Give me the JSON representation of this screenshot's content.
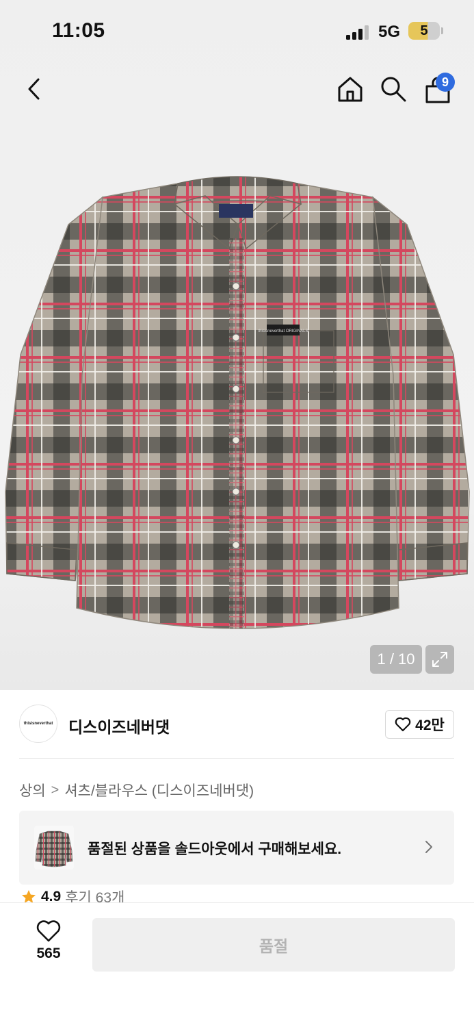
{
  "status_bar": {
    "time": "11:05",
    "network": "5G",
    "battery": "5"
  },
  "header": {
    "back_icon": "chevron-left-icon",
    "home_icon": "home-icon",
    "search_icon": "search-icon",
    "cart_icon": "shopping-bag-icon",
    "cart_count": "9"
  },
  "gallery": {
    "pager": "1 / 10",
    "expand_icon": "expand-icon",
    "label_text": "thisisneverthat ORIGINALS"
  },
  "brand": {
    "logo_text": "thisisneverthat",
    "name": "디스이즈네버댓",
    "like_count": "42만",
    "like_icon": "heart-outline-icon"
  },
  "breadcrumb": {
    "category": "상의",
    "separator": ">",
    "subcategory": "셔츠/블라우스 (디스이즈네버댓)"
  },
  "soldout_banner": {
    "text": "품절된 상품을 솔드아웃에서 구매해보세요."
  },
  "rating": {
    "score": "4.9",
    "reviews": "후기 63개"
  },
  "bottom_bar": {
    "wish_count": "565",
    "button_label": "품절"
  },
  "colors": {
    "accent_badge": "#2f6bdf",
    "star": "#f5a623",
    "plaid_base": "#b3ab9f",
    "plaid_dark": "#2d2f2c",
    "plaid_red": "#d4475e"
  }
}
